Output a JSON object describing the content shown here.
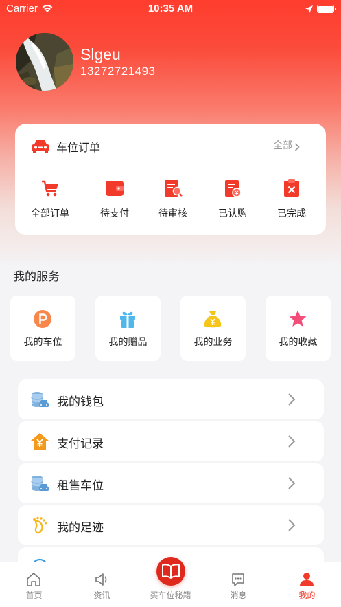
{
  "status_bar": {
    "carrier": "Carrier",
    "time": "10:35 AM",
    "wifi_icon": "wifi-icon",
    "location_icon": "location-arrow-icon",
    "battery_icon": "battery-icon"
  },
  "profile": {
    "name": "Slgeu",
    "phone": "13272721493",
    "avatar_icon": "waterfall-photo"
  },
  "order_card": {
    "title": "车位订单",
    "title_icon": "car-icon",
    "all_label": "全部",
    "items": [
      {
        "label": "全部订单",
        "icon": "shopping-cart-icon"
      },
      {
        "label": "待支付",
        "icon": "wallet-icon"
      },
      {
        "label": "待审核",
        "icon": "review-document-icon"
      },
      {
        "label": "已认购",
        "icon": "subscribed-document-icon"
      },
      {
        "label": "已完成",
        "icon": "completed-clipboard-icon"
      }
    ]
  },
  "services": {
    "title": "我的服务",
    "items": [
      {
        "label": "我的车位",
        "icon": "parking-icon"
      },
      {
        "label": "我的赠品",
        "icon": "gift-icon"
      },
      {
        "label": "我的业务",
        "icon": "money-bag-icon"
      },
      {
        "label": "我的收藏",
        "icon": "star-icon"
      }
    ]
  },
  "menu": [
    {
      "label": "我的钱包",
      "icon": "coins-car-icon"
    },
    {
      "label": "支付记录",
      "icon": "house-yuan-icon"
    },
    {
      "label": "租售车位",
      "icon": "coins-car-icon"
    },
    {
      "label": "我的足迹",
      "icon": "footprint-icon"
    }
  ],
  "tab_bar": {
    "items": [
      {
        "label": "首页",
        "icon": "home-icon"
      },
      {
        "label": "资讯",
        "icon": "speaker-icon"
      },
      {
        "label": "买车位秘籍",
        "icon": "book-icon"
      },
      {
        "label": "消息",
        "icon": "message-icon"
      },
      {
        "label": "我的",
        "icon": "person-icon"
      }
    ],
    "active": "我的"
  },
  "colors": {
    "accent": "#f23a2b",
    "header_gradient_top": "#ff3d2e",
    "background": "#f4f4f6"
  }
}
